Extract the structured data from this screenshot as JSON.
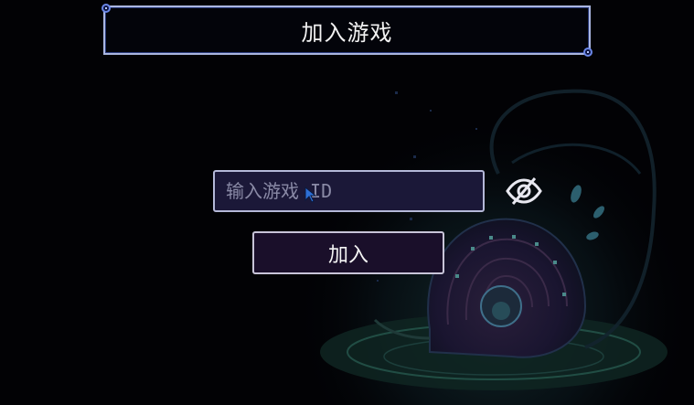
{
  "title": "加入游戏",
  "game_id_input": {
    "value": "",
    "placeholder": "输入游戏 ID"
  },
  "visibility_toggle_icon": "eye-slash-icon",
  "join_button_label": "加入",
  "colors": {
    "background": "#020205",
    "panel_border": "#aab6e0",
    "corner_accent": "#6a86e6",
    "input_bg": "#1b1838",
    "button_bg": "#1a0f2a",
    "art_teal": "#3f8f8a",
    "art_blue": "#3a5fb0"
  }
}
